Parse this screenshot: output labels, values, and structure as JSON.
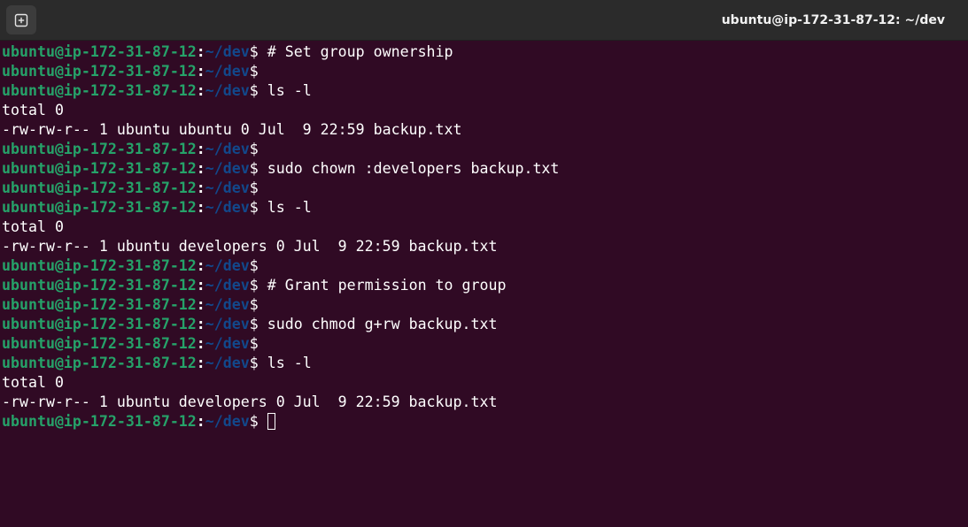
{
  "window": {
    "title": "ubuntu@ip-172-31-87-12: ~/dev",
    "new_tab_icon": "new-tab-icon"
  },
  "prompt": {
    "user_host": "ubuntu@ip-172-31-87-12",
    "colon": ":",
    "path": "~/dev",
    "dollar": "$ "
  },
  "colors": {
    "background": "#300a24",
    "titlebar": "#2b2b2b",
    "user_host": "#26a269",
    "path": "#12488b",
    "text": "#ffffff"
  },
  "lines": [
    {
      "type": "prompt",
      "text": "# Set group ownership"
    },
    {
      "type": "prompt",
      "text": ""
    },
    {
      "type": "prompt",
      "text": "ls -l"
    },
    {
      "type": "output",
      "text": "total 0"
    },
    {
      "type": "output",
      "text": "-rw-rw-r-- 1 ubuntu ubuntu 0 Jul  9 22:59 backup.txt"
    },
    {
      "type": "prompt",
      "text": ""
    },
    {
      "type": "prompt",
      "text": "sudo chown :developers backup.txt"
    },
    {
      "type": "prompt",
      "text": ""
    },
    {
      "type": "prompt",
      "text": "ls -l"
    },
    {
      "type": "output",
      "text": "total 0"
    },
    {
      "type": "output",
      "text": "-rw-rw-r-- 1 ubuntu developers 0 Jul  9 22:59 backup.txt"
    },
    {
      "type": "prompt",
      "text": ""
    },
    {
      "type": "prompt",
      "text": "# Grant permission to group"
    },
    {
      "type": "prompt",
      "text": ""
    },
    {
      "type": "prompt",
      "text": "sudo chmod g+rw backup.txt"
    },
    {
      "type": "prompt",
      "text": ""
    },
    {
      "type": "prompt",
      "text": "ls -l"
    },
    {
      "type": "output",
      "text": "total 0"
    },
    {
      "type": "output",
      "text": "-rw-rw-r-- 1 ubuntu developers 0 Jul  9 22:59 backup.txt"
    },
    {
      "type": "active",
      "text": ""
    }
  ]
}
